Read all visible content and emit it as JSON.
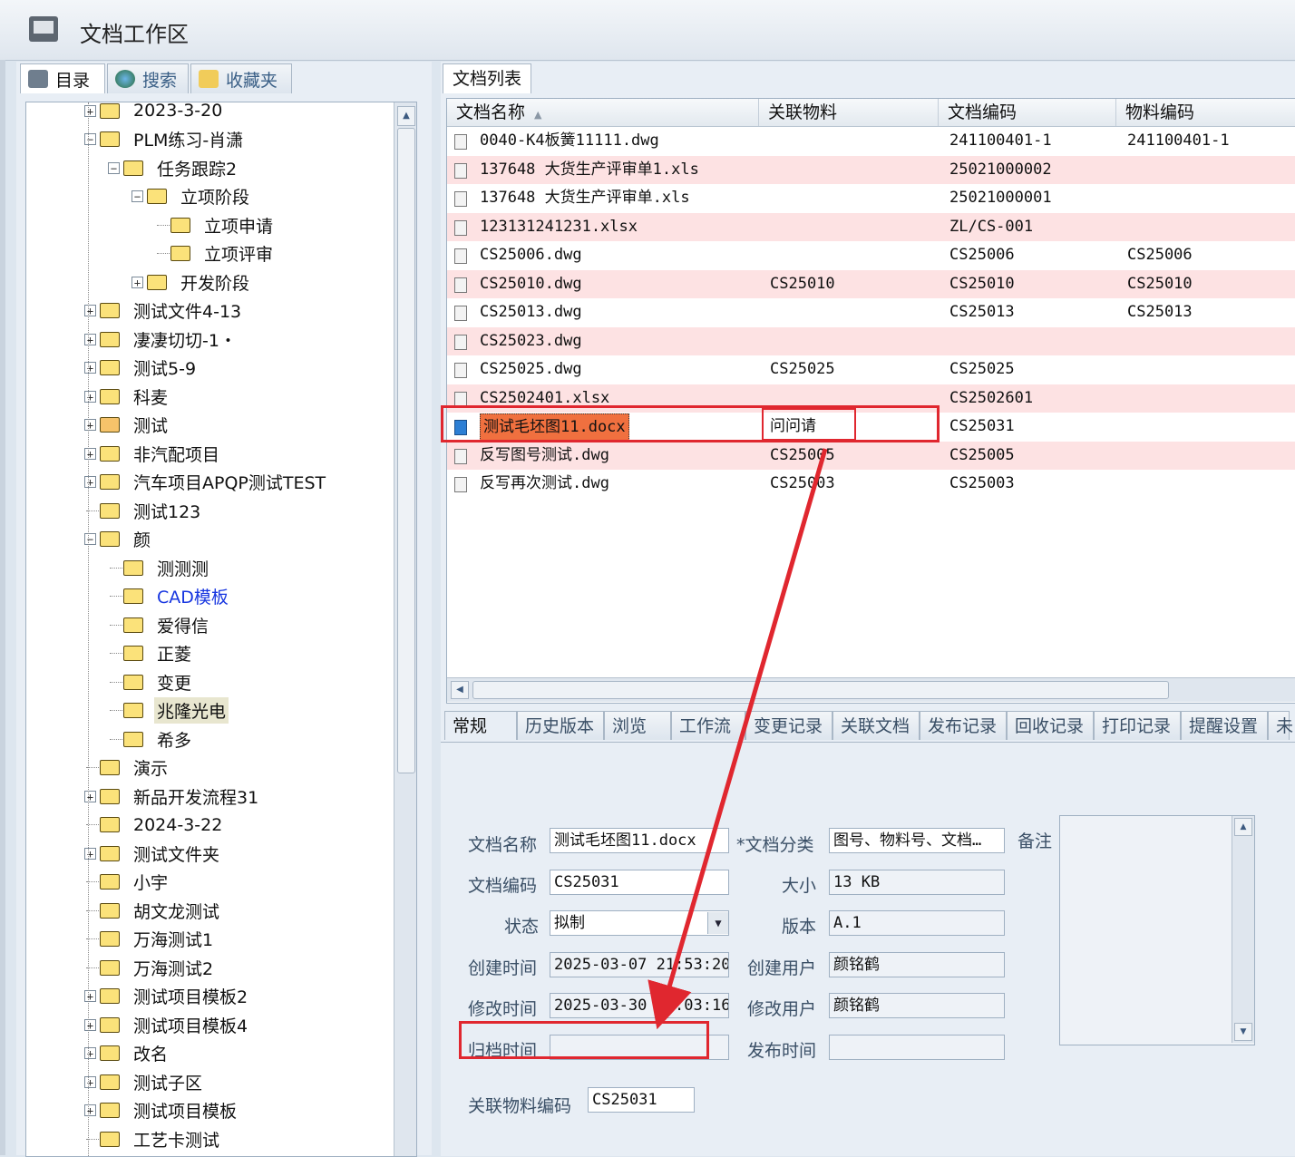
{
  "window": {
    "title": "文档工作区"
  },
  "left_tabs": [
    {
      "label": "目录",
      "icon": "directory-icon",
      "active": true
    },
    {
      "label": "搜索",
      "icon": "search-globe-icon",
      "active": false
    },
    {
      "label": "收藏夹",
      "icon": "favorites-icon",
      "active": false
    }
  ],
  "tree": [
    {
      "label": "2023-3-20",
      "level": 0,
      "expander": "+"
    },
    {
      "label": "PLM练习-肖潇",
      "level": 0,
      "expander": "-"
    },
    {
      "label": "任务跟踪2",
      "level": 1,
      "expander": "-"
    },
    {
      "label": "立项阶段",
      "level": 2,
      "expander": "-"
    },
    {
      "label": "立项申请",
      "level": 3,
      "expander": ""
    },
    {
      "label": "立项评审",
      "level": 3,
      "expander": ""
    },
    {
      "label": "开发阶段",
      "level": 2,
      "expander": "+"
    },
    {
      "label": "测试文件4-13",
      "level": 0,
      "expander": "+"
    },
    {
      "label": "凄凄切切-1・",
      "level": 0,
      "expander": "+"
    },
    {
      "label": "测试5-9",
      "level": 0,
      "expander": "+"
    },
    {
      "label": "科麦",
      "level": 0,
      "expander": "+"
    },
    {
      "label": "测试",
      "level": 0,
      "expander": "+",
      "special": true
    },
    {
      "label": "非汽配项目",
      "level": 0,
      "expander": "+"
    },
    {
      "label": "汽车项目APQP测试TEST",
      "level": 0,
      "expander": "+"
    },
    {
      "label": "测试123",
      "level": 0,
      "expander": ""
    },
    {
      "label": "颜",
      "level": 0,
      "expander": "-"
    },
    {
      "label": "测测测",
      "level": 1,
      "expander": ""
    },
    {
      "label": "CAD模板",
      "level": 1,
      "expander": "",
      "blue": true
    },
    {
      "label": "爱得信",
      "level": 1,
      "expander": ""
    },
    {
      "label": "正菱",
      "level": 1,
      "expander": ""
    },
    {
      "label": "变更",
      "level": 1,
      "expander": ""
    },
    {
      "label": "兆隆光电",
      "level": 1,
      "expander": "",
      "selected": true
    },
    {
      "label": "希多",
      "level": 1,
      "expander": ""
    },
    {
      "label": "演示",
      "level": 0,
      "expander": ""
    },
    {
      "label": "新品开发流程31",
      "level": 0,
      "expander": "+"
    },
    {
      "label": "2024-3-22",
      "level": 0,
      "expander": ""
    },
    {
      "label": "测试文件夹",
      "level": 0,
      "expander": "+"
    },
    {
      "label": "小宇",
      "level": 0,
      "expander": ""
    },
    {
      "label": "胡文龙测试",
      "level": 0,
      "expander": ""
    },
    {
      "label": "万海测试1",
      "level": 0,
      "expander": ""
    },
    {
      "label": "万海测试2",
      "level": 0,
      "expander": ""
    },
    {
      "label": "测试项目模板2",
      "level": 0,
      "expander": "+"
    },
    {
      "label": "测试项目模板4",
      "level": 0,
      "expander": "+"
    },
    {
      "label": "改名",
      "level": 0,
      "expander": "+"
    },
    {
      "label": "测试子区",
      "level": 0,
      "expander": "+"
    },
    {
      "label": "测试项目模板",
      "level": 0,
      "expander": "+"
    },
    {
      "label": "工艺卡测试",
      "level": 0,
      "expander": ""
    }
  ],
  "list_tab": "文档列表",
  "columns": [
    "文档名称",
    "关联物料",
    "文档编码",
    "物料编码"
  ],
  "rows": [
    {
      "name": "0040-K4板簧11111.dwg",
      "material": "",
      "code": "241100401-1",
      "mcode": "241100401-1",
      "pink": false
    },
    {
      "name": "137648 大货生产评审单1.xls",
      "material": "",
      "code": "25021000002",
      "mcode": "",
      "pink": true
    },
    {
      "name": "137648 大货生产评审单.xls",
      "material": "",
      "code": "25021000001",
      "mcode": "",
      "pink": false
    },
    {
      "name": "123131241231.xlsx",
      "material": "",
      "code": "ZL/CS-001",
      "mcode": "",
      "pink": true
    },
    {
      "name": "CS25006.dwg",
      "material": "",
      "code": "CS25006",
      "mcode": "CS25006",
      "pink": false
    },
    {
      "name": "CS25010.dwg",
      "material": "CS25010",
      "code": "CS25010",
      "mcode": "CS25010",
      "pink": true
    },
    {
      "name": "CS25013.dwg",
      "material": "",
      "code": "CS25013",
      "mcode": "CS25013",
      "pink": false
    },
    {
      "name": "CS25023.dwg",
      "material": "",
      "code": "",
      "mcode": "",
      "pink": true
    },
    {
      "name": "CS25025.dwg",
      "material": "CS25025",
      "code": "CS25025",
      "mcode": "",
      "pink": false
    },
    {
      "name": "CS2502401.xlsx",
      "material": "",
      "code": "CS2502601",
      "mcode": "",
      "pink": true
    },
    {
      "name": "测试毛坯图11.docx",
      "material": "问问请",
      "code": "CS25031",
      "mcode": "",
      "pink": false,
      "selected": true
    },
    {
      "name": "反写图号测试.dwg",
      "material": "CS25005",
      "code": "CS25005",
      "mcode": "",
      "pink": true
    },
    {
      "name": "反写再次测试.dwg",
      "material": "CS25003",
      "code": "CS25003",
      "mcode": "",
      "pink": false
    }
  ],
  "detail_tabs": [
    "常规",
    "历史版本",
    "浏览",
    "工作流",
    "变更记录",
    "关联文档",
    "发布记录",
    "回收记录",
    "打印记录",
    "提醒设置",
    "未"
  ],
  "detail": {
    "doc_name_label": "文档名称",
    "doc_name": "测试毛坯图11.docx",
    "doc_category_label": "*文档分类",
    "doc_category": "图号、物料号、文档…",
    "remark_label": "备注",
    "doc_code_label": "文档编码",
    "doc_code": "CS25031",
    "size_label": "大小",
    "size": "13 KB",
    "status_label": "状态",
    "status": "拟制",
    "version_label": "版本",
    "version": "A.1",
    "created_label": "创建时间",
    "created": "2025-03-07 21:53:20",
    "creator_label": "创建用户",
    "creator": "颜铭鹤",
    "modified_label": "修改时间",
    "modified": "2025-03-30 15:03:16",
    "modifier_label": "修改用户",
    "modifier": "颜铭鹤",
    "archived_label": "归档时间",
    "archived": "",
    "published_label": "发布时间",
    "published": "",
    "material_code_label": "关联物料编码",
    "material_code": "CS25031"
  },
  "annotation_color": "#e0272f"
}
